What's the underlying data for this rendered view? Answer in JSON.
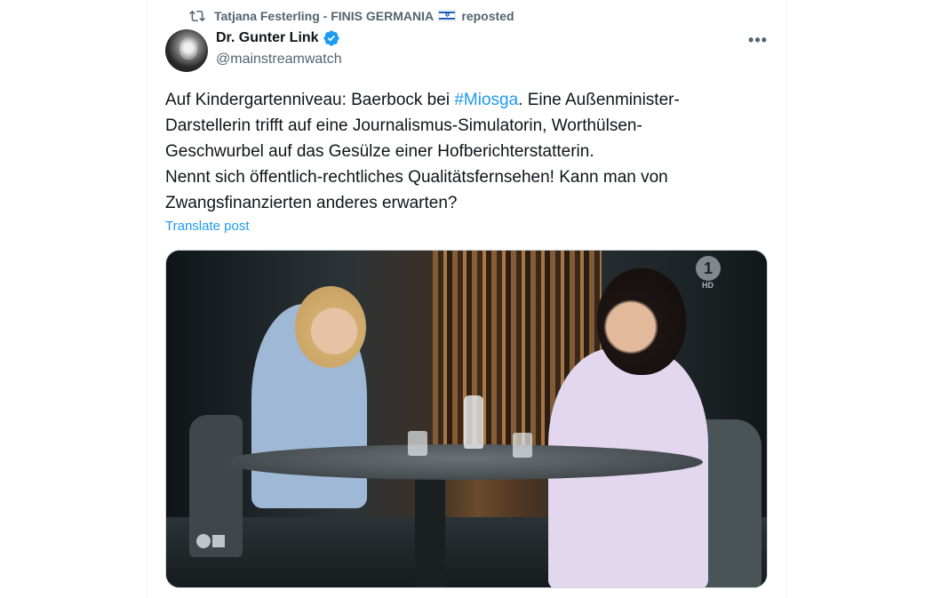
{
  "repost": {
    "user": "Tatjana Festerling - FINIS GERMANIA",
    "flag": "flag-israel-icon",
    "suffix": "reposted"
  },
  "author": {
    "name": "Dr. Gunter Link",
    "handle": "@mainstreamwatch",
    "verified": true,
    "verified_color": "#1d9bf0"
  },
  "more_label": "•••",
  "post": {
    "line1_before": "Auf Kindergartenniveau: Baerbock bei ",
    "hashtag": "#Miosga",
    "line1_after": ". Eine Außenminister-",
    "line2": "Darstellerin trifft auf eine Journalismus-Simulatorin, Worthülsen-",
    "line3": "Geschwurbel auf das Gesülze einer Hofberichterstatterin.",
    "line4": "Nennt sich öffentlich-rechtliches Qualitätsfernsehen! Kann man von",
    "line5": "Zwangsfinanzierten anderes erwarten?"
  },
  "translate_label": "Translate post",
  "media": {
    "channel_logo_text": "1",
    "channel_hd": "HD"
  },
  "colors": {
    "link": "#1d9bf0",
    "secondary_text": "#536471",
    "primary_text": "#0f1419"
  }
}
